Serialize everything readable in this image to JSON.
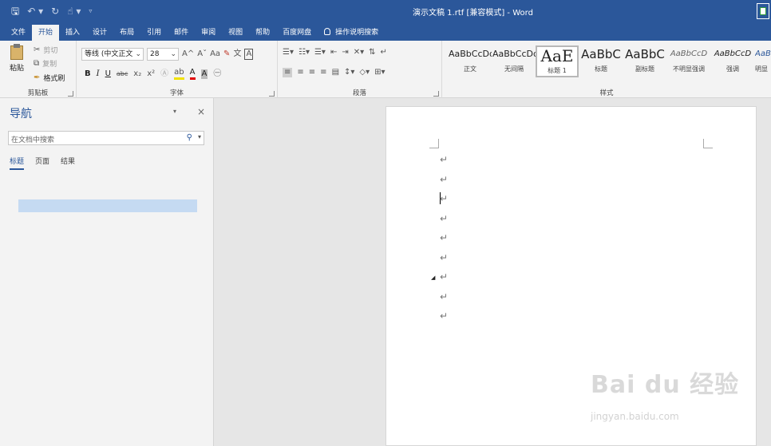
{
  "titlebar": {
    "title": "演示文稿 1.rtf [兼容模式] - Word",
    "qat_icons": [
      "save-icon",
      "undo-icon",
      "redo-icon",
      "touch-mode-icon",
      "customize-qat-icon"
    ]
  },
  "tabs": [
    "文件",
    "开始",
    "插入",
    "设计",
    "布局",
    "引用",
    "邮件",
    "审阅",
    "视图",
    "帮助",
    "百度网盘",
    "操作说明搜索"
  ],
  "active_tab": "开始",
  "ribbon": {
    "clipboard": {
      "label": "剪贴板",
      "paste": "粘贴",
      "cut": "剪切",
      "copy": "复制",
      "format_painter": "格式刷"
    },
    "font": {
      "label": "字体",
      "font_name": "等线 (中文正文",
      "font_size": "28",
      "bold": "B",
      "italic": "I",
      "underline": "U",
      "strikethrough": "abc",
      "subscript": "x₂",
      "superscript": "x²",
      "grow": "A^",
      "shrink": "Aˇ",
      "change_case": "Aa",
      "phonetic": "文",
      "char_border": "A"
    },
    "paragraph": {
      "label": "段落"
    },
    "styles": {
      "label": "样式",
      "items": [
        {
          "sample": "AaBbCcDd",
          "name": "正文"
        },
        {
          "sample": "AaBbCcDd",
          "name": "无间隔"
        },
        {
          "sample": "AaE",
          "name": "标题 1"
        },
        {
          "sample": "AaBbC",
          "name": "标题"
        },
        {
          "sample": "AaBbC",
          "name": "副标题"
        },
        {
          "sample": "AaBbCcD",
          "name": "不明显强调"
        },
        {
          "sample": "AaBbCcD",
          "name": "强调"
        },
        {
          "sample": "AaB",
          "name": "明显"
        }
      ]
    }
  },
  "navigation": {
    "title": "导航",
    "search_placeholder": "在文档中搜索",
    "tabs": [
      "标题",
      "页面",
      "结果"
    ],
    "active_tab": "标题"
  },
  "document": {
    "paragraph_mark": "↵",
    "paragraph_count": 9
  },
  "watermark": {
    "brand": "Bai du 经验",
    "url": "jingyan.baidu.com"
  }
}
